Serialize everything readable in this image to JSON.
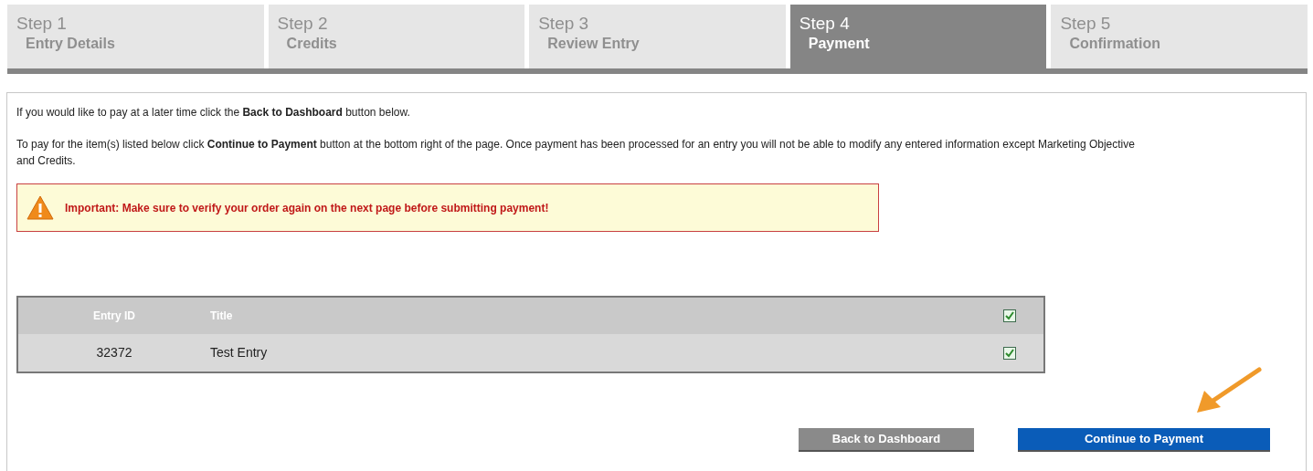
{
  "steps": [
    {
      "step": "Step 1",
      "label": "Entry Details",
      "selected": false
    },
    {
      "step": "Step 2",
      "label": "Credits",
      "selected": false
    },
    {
      "step": "Step 3",
      "label": "Review Entry",
      "selected": false
    },
    {
      "step": "Step 4",
      "label": "Payment",
      "selected": true
    },
    {
      "step": "Step 5",
      "label": "Confirmation",
      "selected": false
    }
  ],
  "intro": "If you would like to pay at a later time click the **Back to Dashboard** button below.",
  "instructions": "To pay for the item(s) listed below click **Continue to Payment** button at the bottom right of the page. Once payment has been processed for an entry you will not be able to modify any entered information except Marketing Objective and Credits.",
  "alert": {
    "text": "Important: Make sure to verify your order again on the next page before submitting payment!"
  },
  "table": {
    "columns": [
      "Entry ID",
      "Title"
    ],
    "header_checked": true,
    "rows": [
      {
        "id": "32372",
        "title": "Test Entry",
        "checked": true
      }
    ]
  },
  "buttons": {
    "back": "Back to Dashboard",
    "continue": "Continue to Payment"
  }
}
